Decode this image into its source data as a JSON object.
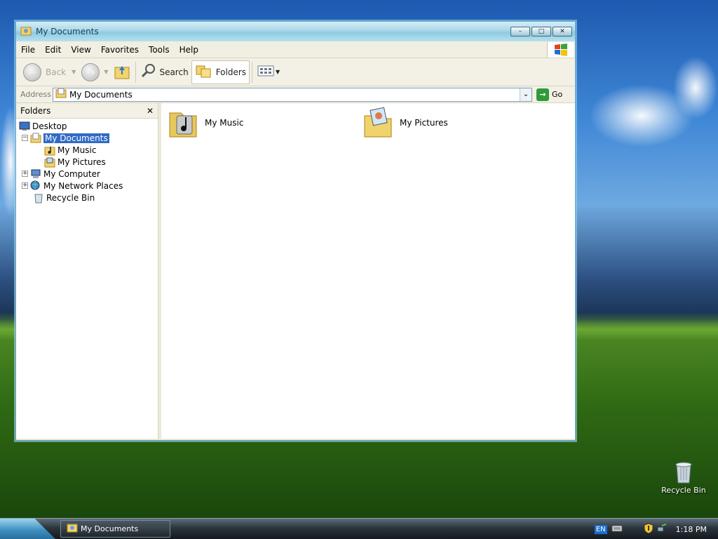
{
  "desktop": {
    "icons": [
      {
        "label": "Recycle Bin"
      }
    ]
  },
  "window": {
    "title": "My Documents",
    "buttons": {
      "minimize": "–",
      "maximize": "□",
      "close": "✕"
    },
    "menu": [
      "File",
      "Edit",
      "View",
      "Favorites",
      "Tools",
      "Help"
    ],
    "toolbar": {
      "back": "Back",
      "search": "Search",
      "folders": "Folders"
    },
    "address": {
      "label": "Address",
      "value": "My Documents",
      "go": "Go"
    },
    "folders_pane": {
      "title": "Folders",
      "close": "✕",
      "tree": [
        {
          "label": "Desktop"
        },
        {
          "label": "My Documents"
        },
        {
          "label": "My Music"
        },
        {
          "label": "My Pictures"
        },
        {
          "label": "My Computer"
        },
        {
          "label": "My Network Places"
        },
        {
          "label": "Recycle Bin"
        }
      ]
    },
    "items": [
      {
        "label": "My Music"
      },
      {
        "label": "My Pictures"
      }
    ]
  },
  "taskbar": {
    "task": "My Documents",
    "language": "EN",
    "clock": "1:18 PM"
  },
  "colors": {
    "selection": "#316ac5",
    "titlebar": "#a9d7e9",
    "chrome": "#ece9d8"
  }
}
